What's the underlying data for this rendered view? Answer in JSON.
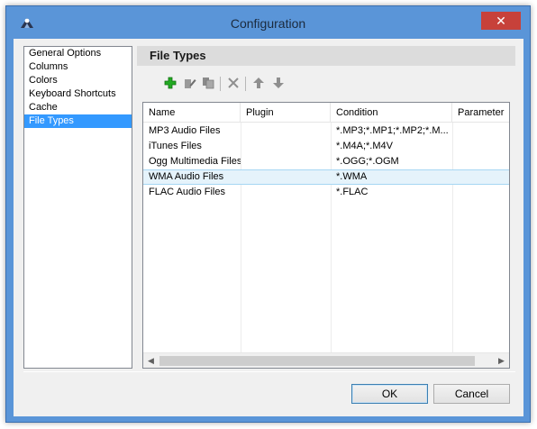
{
  "window": {
    "title": "Configuration",
    "close_label": "✕"
  },
  "sidebar": {
    "items": [
      {
        "label": "General Options",
        "selected": false
      },
      {
        "label": "Columns",
        "selected": false
      },
      {
        "label": "Colors",
        "selected": false
      },
      {
        "label": "Keyboard Shortcuts",
        "selected": false
      },
      {
        "label": "Cache",
        "selected": false
      },
      {
        "label": "File Types",
        "selected": true
      }
    ]
  },
  "panel": {
    "header": "File Types",
    "toolbar": [
      "add-icon",
      "edit-icon",
      "copy-icon",
      "delete-icon",
      "move-up-icon",
      "move-down-icon"
    ]
  },
  "table": {
    "columns": [
      "Name",
      "Plugin",
      "Condition",
      "Parameter"
    ],
    "rows": [
      {
        "name": "MP3 Audio Files",
        "plugin": "",
        "condition": "*.MP3;*.MP1;*.MP2;*.M...",
        "parameter": "",
        "selected": false
      },
      {
        "name": "iTunes Files",
        "plugin": "",
        "condition": "*.M4A;*.M4V",
        "parameter": "",
        "selected": false
      },
      {
        "name": "Ogg Multimedia Files",
        "plugin": "",
        "condition": "*.OGG;*.OGM",
        "parameter": "",
        "selected": false
      },
      {
        "name": "WMA Audio Files",
        "plugin": "",
        "condition": "*.WMA",
        "parameter": "",
        "selected": true
      },
      {
        "name": "FLAC Audio Files",
        "plugin": "",
        "condition": "*.FLAC",
        "parameter": "",
        "selected": false
      }
    ]
  },
  "buttons": {
    "ok": "OK",
    "cancel": "Cancel"
  },
  "colors": {
    "titlebar": "#5a95d8",
    "close": "#c7413a",
    "selection": "#3399ff",
    "add_green": "#22aa22"
  }
}
